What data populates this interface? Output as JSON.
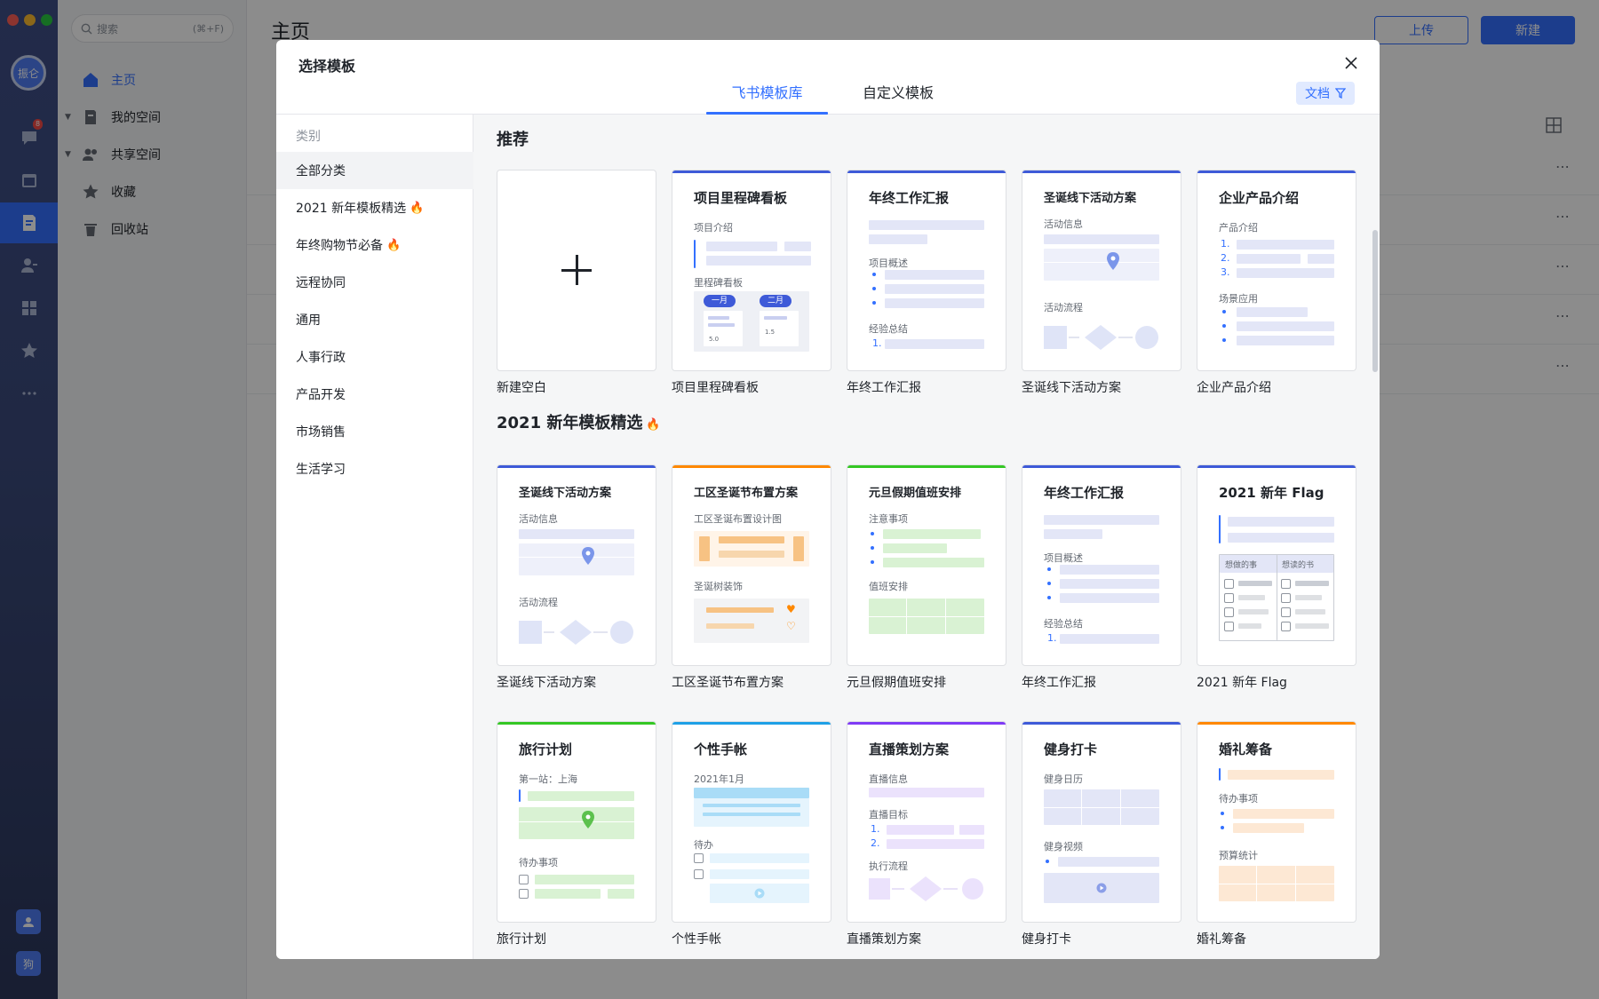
{
  "sidebar_rail": {
    "avatar_label": "振仑",
    "badge_count": "8",
    "bottom_avatar_label": "狗"
  },
  "leftnav": {
    "search_placeholder": "搜索",
    "search_shortcut": "(⌘+F)",
    "items": [
      {
        "label": "主页"
      },
      {
        "label": "我的空间"
      },
      {
        "label": "共享空间"
      },
      {
        "label": "收藏"
      },
      {
        "label": "回收站"
      }
    ]
  },
  "main": {
    "title": "主页",
    "upload_label": "上传",
    "new_label": "新建"
  },
  "modal": {
    "title": "选择模板",
    "tabs": [
      {
        "label": "飞书模板库"
      },
      {
        "label": "自定义模板"
      }
    ],
    "filter_label": "文档",
    "category_header": "类别",
    "categories": [
      {
        "label": "全部分类"
      },
      {
        "label": "2021 新年模板精选"
      },
      {
        "label": "年终购物节必备"
      },
      {
        "label": "远程协同"
      },
      {
        "label": "通用"
      },
      {
        "label": "人事行政"
      },
      {
        "label": "产品开发"
      },
      {
        "label": "市场销售"
      },
      {
        "label": "生活学习"
      }
    ],
    "sections": [
      {
        "title": "推荐",
        "cards": [
          {
            "caption": "新建空白"
          },
          {
            "caption": "项目里程碑看板",
            "title": "项目里程碑看板",
            "s1": "项目介绍",
            "s2": "里程碑看板",
            "m1": "一月",
            "m2": "二月",
            "v1": "5.0",
            "v2": "1.5"
          },
          {
            "caption": "年终工作汇报",
            "title": "年终工作汇报",
            "s1": "项目概述",
            "s2": "经验总结",
            "n1": "1."
          },
          {
            "caption": "圣诞线下活动方案",
            "title": "圣诞线下活动方案",
            "s1": "活动信息",
            "s2": "活动流程"
          },
          {
            "caption": "企业产品介绍",
            "title": "企业产品介绍",
            "s1": "产品介绍",
            "s2": "场景应用",
            "n1": "1.",
            "n2": "2.",
            "n3": "3."
          }
        ]
      },
      {
        "title": "2021 新年模板精选",
        "cards": [
          {
            "caption": "圣诞线下活动方案",
            "title": "圣诞线下活动方案",
            "s1": "活动信息",
            "s2": "活动流程"
          },
          {
            "caption": "工区圣诞节布置方案",
            "title": "工区圣诞节布置方案",
            "s1": "工区圣诞布置设计图",
            "s2": "圣诞树装饰"
          },
          {
            "caption": "元旦假期值班安排",
            "title": "元旦假期值班安排",
            "s1": "注意事项",
            "s2": "值班安排"
          },
          {
            "caption": "年终工作汇报",
            "title": "年终工作汇报",
            "s1": "项目概述",
            "s2": "经验总结",
            "n1": "1."
          },
          {
            "caption": "2021 新年 Flag",
            "title": "2021 新年 Flag",
            "h1": "想做的事",
            "h2": "想读的书"
          }
        ]
      },
      {
        "title": "",
        "cards": [
          {
            "caption": "旅行计划",
            "title": "旅行计划",
            "s1": "第一站：上海",
            "s2": "待办事项"
          },
          {
            "caption": "个性手帐",
            "title": "个性手帐",
            "s1": "2021年1月",
            "s2": "待办"
          },
          {
            "caption": "直播策划方案",
            "title": "直播策划方案",
            "s1": "直播信息",
            "s2": "直播目标",
            "s3": "执行流程",
            "n1": "1.",
            "n2": "2."
          },
          {
            "caption": "健身打卡",
            "title": "健身打卡",
            "s1": "健身日历",
            "s2": "健身视频"
          },
          {
            "caption": "婚礼筹备",
            "title": "婚礼筹备",
            "s1": "待办事项",
            "s2": "预算统计"
          }
        ]
      }
    ]
  },
  "colors": {
    "accent": "#3370ff",
    "card_bar_blue": "#3e5ad8",
    "card_bar_orange": "#ff8800",
    "card_bar_green": "#34c724",
    "card_bar_cyan": "#1ea0e6",
    "card_bar_purple": "#7f3bf5"
  }
}
